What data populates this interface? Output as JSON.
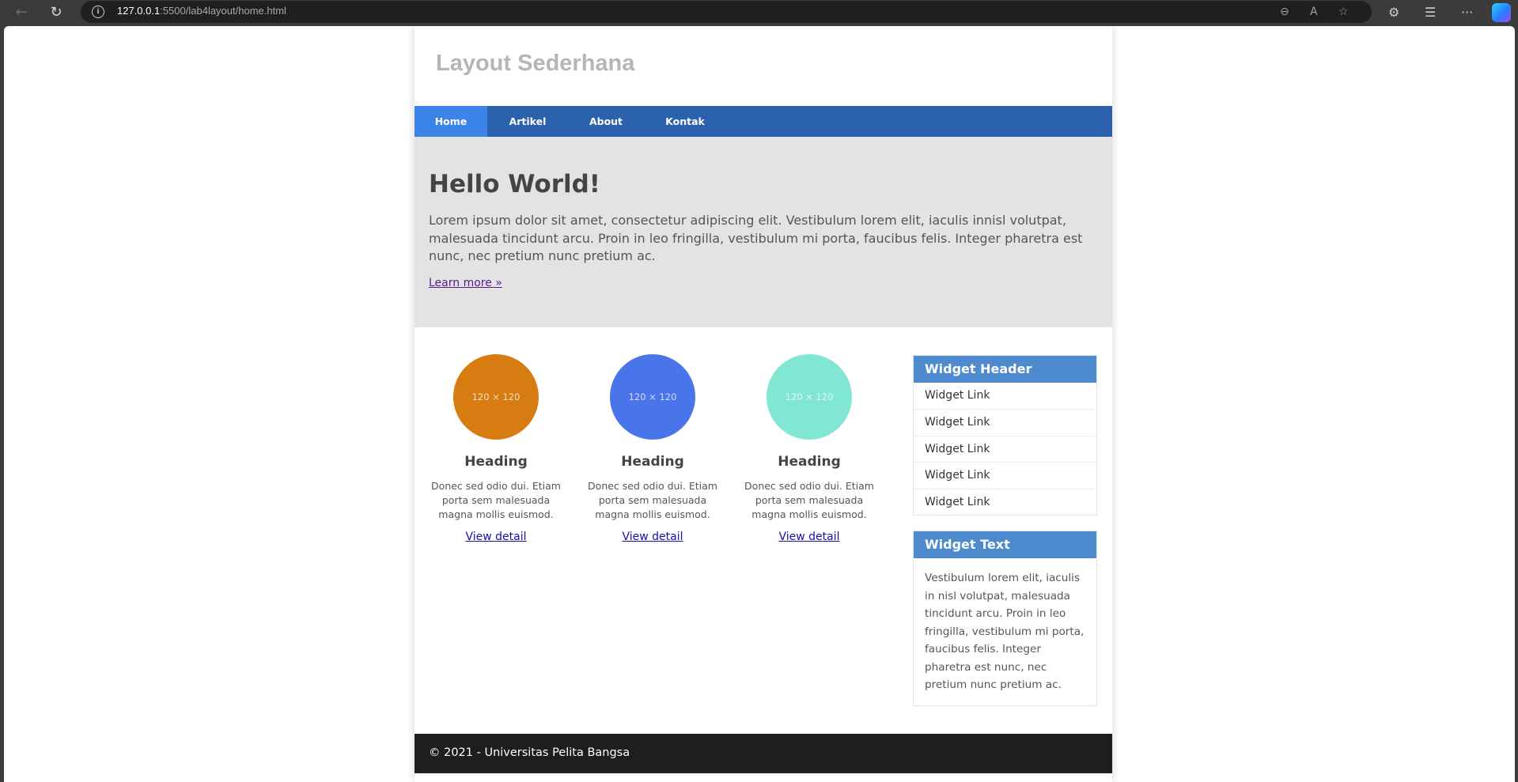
{
  "browser": {
    "url_host": "127.0.0.1",
    "url_rest": ":5500/lab4layout/home.html"
  },
  "site": {
    "title": "Layout Sederhana",
    "nav": [
      "Home",
      "Artikel",
      "About",
      "Kontak"
    ],
    "active_nav": "Home",
    "hero": {
      "heading": "Hello World!",
      "text": "Lorem ipsum dolor sit amet, consectetur adipiscing elit. Vestibulum lorem elit, iaculis innisl volutpat, malesuada tincidunt arcu. Proin in leo fringilla, vestibulum mi porta, faucibus felis. Integer pharetra est nunc, nec pretium nunc pretium ac.",
      "link": "Learn more »"
    },
    "columns": [
      {
        "image_label": "120 × 120",
        "color": "#d67c11",
        "heading": "Heading",
        "text": "Donec sed odio dui. Etiam porta sem malesuada magna mollis euismod.",
        "link": "View detail"
      },
      {
        "image_label": "120 × 120",
        "color": "#4a75ea",
        "heading": "Heading",
        "text": "Donec sed odio dui. Etiam porta sem malesuada magna mollis euismod.",
        "link": "View detail"
      },
      {
        "image_label": "120 × 120",
        "color": "#81e6d3",
        "heading": "Heading",
        "text": "Donec sed odio dui. Etiam porta sem malesuada magna mollis euismod.",
        "link": "View detail"
      }
    ],
    "widget_links": {
      "header": "Widget Header",
      "items": [
        "Widget Link",
        "Widget Link",
        "Widget Link",
        "Widget Link",
        "Widget Link"
      ]
    },
    "widget_text": {
      "header": "Widget Text",
      "body": "Vestibulum lorem elit, iaculis in nisl volutpat, malesuada tincidunt arcu. Proin in leo fringilla, vestibulum mi porta, faucibus felis. Integer pharetra est nunc, nec pretium nunc pretium ac."
    },
    "footer": "© 2021 - Universitas Pelita Bangsa"
  },
  "colors": {
    "nav_bg": "#2b61ad",
    "nav_active": "#3d84e9",
    "widget_header": "#4d8ace",
    "hero_bg": "#e3e3e3",
    "footer_bg": "#1e1e1e"
  }
}
